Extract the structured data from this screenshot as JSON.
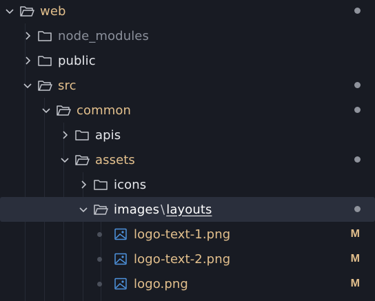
{
  "tree": {
    "rows": [
      {
        "label": "web",
        "kind": "folder",
        "expanded": true,
        "depth": 0,
        "modified": true
      },
      {
        "label": "node_modules",
        "kind": "folder",
        "expanded": false,
        "depth": 1,
        "muted": true
      },
      {
        "label": "public",
        "kind": "folder",
        "expanded": false,
        "depth": 1
      },
      {
        "label": "src",
        "kind": "folder",
        "expanded": true,
        "depth": 1,
        "modified": true
      },
      {
        "label": "common",
        "kind": "folder",
        "expanded": true,
        "depth": 2,
        "modified": true
      },
      {
        "label": "apis",
        "kind": "folder",
        "expanded": false,
        "depth": 3
      },
      {
        "label": "assets",
        "kind": "folder",
        "expanded": true,
        "depth": 3,
        "modified": true
      },
      {
        "label": "icons",
        "kind": "folder",
        "expanded": false,
        "depth": 4
      },
      {
        "label_parts": [
          "images",
          "\\",
          "layouts"
        ],
        "kind": "folder",
        "expanded": true,
        "depth": 4,
        "selected": true
      },
      {
        "label": "logo-text-1.png",
        "kind": "image",
        "depth": 5,
        "status": "M"
      },
      {
        "label": "logo-text-2.png",
        "kind": "image",
        "depth": 5,
        "status": "M"
      },
      {
        "label": "logo.png",
        "kind": "image",
        "depth": 5,
        "status": "M"
      }
    ]
  },
  "colors": {
    "background": "#181b23",
    "selected_row": "#2a2f3c",
    "modified_text": "#e3c08d",
    "image_icon": "#4e94e0"
  },
  "icons": {
    "chevron_down": "chevron-down-icon",
    "chevron_right": "chevron-right-icon",
    "folder": "folder-icon",
    "folder_open": "folder-open-icon",
    "image": "image-file-icon"
  }
}
